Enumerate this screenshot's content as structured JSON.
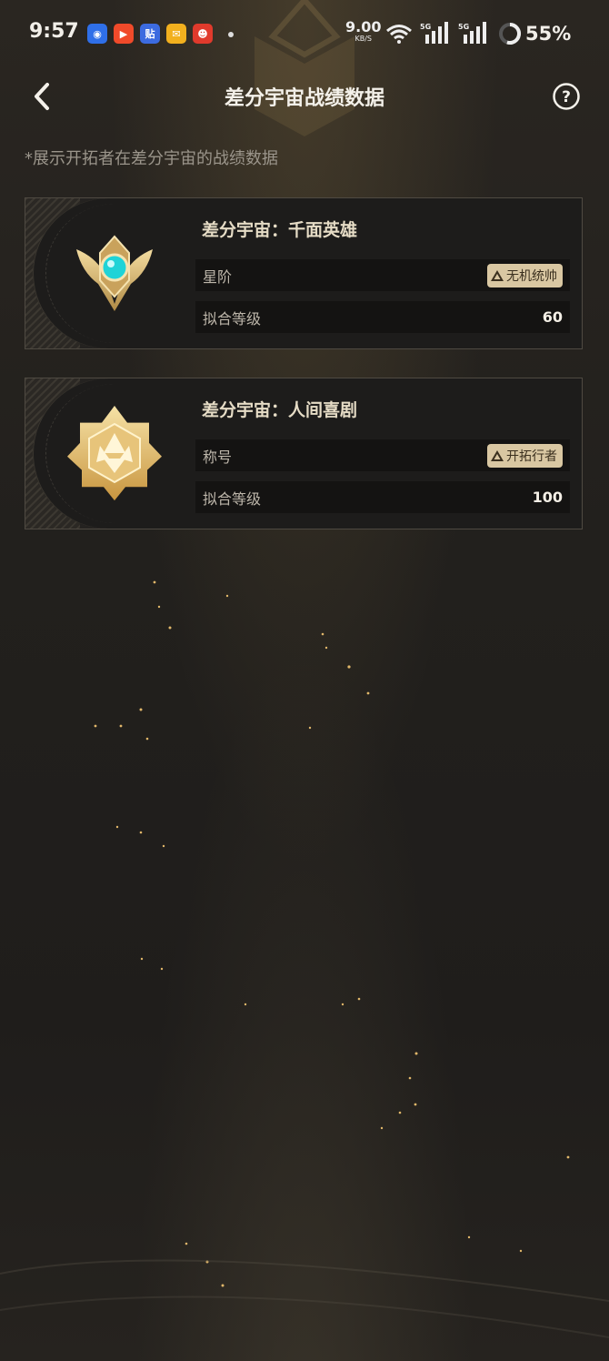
{
  "status_bar": {
    "time": "9:57",
    "net_speed": "9.00",
    "net_unit": "KB/S",
    "network_labels": [
      "5G",
      "5G"
    ],
    "battery": "55%",
    "app_icons": [
      {
        "name": "baidu-map-icon",
        "color": "#2f6fe8",
        "glyph": "◉"
      },
      {
        "name": "video-app-icon",
        "color": "#f04a2a",
        "glyph": "▶"
      },
      {
        "name": "tieba-icon",
        "color": "#3c6be0",
        "glyph": "贴"
      },
      {
        "name": "mail-icon",
        "color": "#f2b01e",
        "glyph": "✉"
      },
      {
        "name": "game-app-icon",
        "color": "#e03a2c",
        "glyph": "☻"
      }
    ]
  },
  "header": {
    "title": "差分宇宙战绩数据"
  },
  "subtitle": "*展示开拓者在差分宇宙的战绩数据",
  "cards": [
    {
      "title": "差分宇宙：千面英雄",
      "row1_label": "星阶",
      "badge": "无机统帅",
      "row2_label": "拟合等级",
      "row2_value": "60"
    },
    {
      "title": "差分宇宙：人间喜剧",
      "row1_label": "称号",
      "badge": "开拓行者",
      "row2_label": "拟合等级",
      "row2_value": "100"
    }
  ],
  "colors": {
    "accent_gold": "#d9c7a2",
    "background": "#22201d"
  }
}
